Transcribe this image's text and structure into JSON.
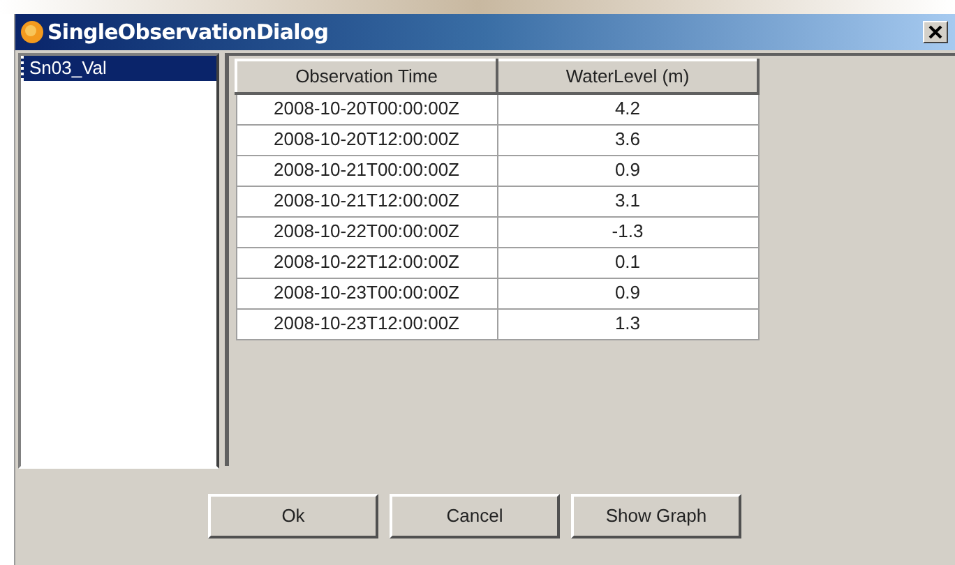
{
  "window": {
    "title": "SingleObservationDialog"
  },
  "list": {
    "items": [
      {
        "label": "Sn03_Val",
        "selected": true
      }
    ]
  },
  "table": {
    "columns": [
      "Observation Time",
      "WaterLevel (m)"
    ],
    "rows": [
      [
        "2008-10-20T00:00:00Z",
        "4.2"
      ],
      [
        "2008-10-20T12:00:00Z",
        "3.6"
      ],
      [
        "2008-10-21T00:00:00Z",
        "0.9"
      ],
      [
        "2008-10-21T12:00:00Z",
        "3.1"
      ],
      [
        "2008-10-22T00:00:00Z",
        "-1.3"
      ],
      [
        "2008-10-22T12:00:00Z",
        "0.1"
      ],
      [
        "2008-10-23T00:00:00Z",
        "0.9"
      ],
      [
        "2008-10-23T12:00:00Z",
        "1.3"
      ]
    ]
  },
  "buttons": [
    "Ok",
    "Cancel",
    "Show Graph"
  ]
}
